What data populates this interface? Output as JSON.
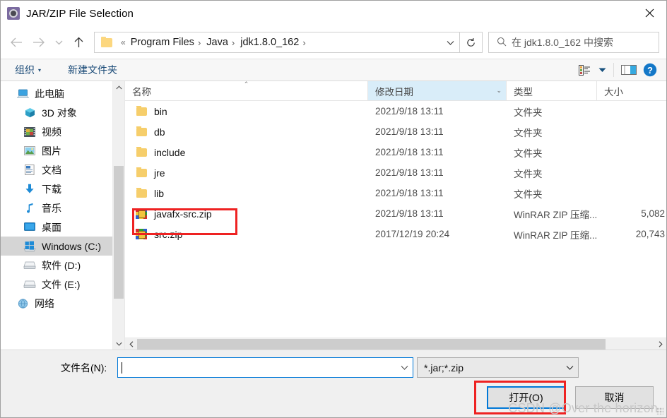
{
  "window": {
    "title": "JAR/ZIP File Selection",
    "title_icon": "java-gear-icon",
    "close_label": "×"
  },
  "nav": {
    "back_icon": "arrow-left-icon",
    "forward_icon": "arrow-right-icon",
    "recent_icon": "chevron-down-icon",
    "up_icon": "arrow-up-icon",
    "address": {
      "folder_icon": "folder-icon",
      "overflow": "«",
      "crumbs": [
        "Program Files",
        "Java",
        "jdk1.8.0_162"
      ],
      "separator": "›",
      "dropdown_icon": "chevron-down-icon"
    },
    "refresh_icon": "refresh-icon",
    "search": {
      "icon": "search-icon",
      "placeholder": "在 jdk1.8.0_162 中搜索",
      "value": ""
    }
  },
  "toolbar": {
    "organize_label": "组织",
    "organize_caret": "▾",
    "new_folder_label": "新建文件夹",
    "view_icon": "view-list-icon",
    "view_caret": "▾",
    "preview_icon": "preview-pane-icon",
    "help_icon": "help-icon",
    "help_glyph": "?"
  },
  "sidebar": {
    "items": [
      {
        "label": "此电脑",
        "icon": "this-pc-icon",
        "indent": false,
        "selected": false
      },
      {
        "label": "3D 对象",
        "icon": "3d-objects-icon",
        "indent": true,
        "selected": false
      },
      {
        "label": "视频",
        "icon": "videos-icon",
        "indent": true,
        "selected": false
      },
      {
        "label": "图片",
        "icon": "pictures-icon",
        "indent": true,
        "selected": false
      },
      {
        "label": "文档",
        "icon": "documents-icon",
        "indent": true,
        "selected": false
      },
      {
        "label": "下载",
        "icon": "downloads-icon",
        "indent": true,
        "selected": false
      },
      {
        "label": "音乐",
        "icon": "music-icon",
        "indent": true,
        "selected": false
      },
      {
        "label": "桌面",
        "icon": "desktop-icon",
        "indent": true,
        "selected": false
      },
      {
        "label": "Windows (C:)",
        "icon": "windows-drive-icon",
        "indent": true,
        "selected": true
      },
      {
        "label": "软件 (D:)",
        "icon": "drive-icon",
        "indent": true,
        "selected": false
      },
      {
        "label": "文件 (E:)",
        "icon": "drive-icon",
        "indent": true,
        "selected": false
      },
      {
        "label": "网络",
        "icon": "network-icon",
        "indent": false,
        "selected": false
      }
    ],
    "scroll_up_icon": "chevron-up-icon",
    "scroll_down_icon": "chevron-down-icon"
  },
  "filelist": {
    "columns": [
      {
        "label": "名称",
        "key": "name",
        "sorted": true,
        "sort_mark": "⌃"
      },
      {
        "label": "修改日期",
        "key": "date",
        "highlighted": true,
        "caret": "⌄"
      },
      {
        "label": "类型",
        "key": "type"
      },
      {
        "label": "大小",
        "key": "size"
      }
    ],
    "rows": [
      {
        "name": "bin",
        "icon": "folder-icon",
        "date": "2021/9/18 13:11",
        "type": "文件夹",
        "size": ""
      },
      {
        "name": "db",
        "icon": "folder-icon",
        "date": "2021/9/18 13:11",
        "type": "文件夹",
        "size": ""
      },
      {
        "name": "include",
        "icon": "folder-icon",
        "date": "2021/9/18 13:11",
        "type": "文件夹",
        "size": ""
      },
      {
        "name": "jre",
        "icon": "folder-icon",
        "date": "2021/9/18 13:11",
        "type": "文件夹",
        "size": ""
      },
      {
        "name": "lib",
        "icon": "folder-icon",
        "date": "2021/9/18 13:11",
        "type": "文件夹",
        "size": ""
      },
      {
        "name": "javafx-src.zip",
        "icon": "winrar-zip-icon",
        "date": "2021/9/18 13:11",
        "type": "WinRAR ZIP 压缩...",
        "size": "5,082"
      },
      {
        "name": "src.zip",
        "icon": "winrar-zip-icon",
        "date": "2017/12/19 20:24",
        "type": "WinRAR ZIP 压缩...",
        "size": "20,743"
      }
    ],
    "highlight_row_index": 6,
    "hscroll": {
      "left_icon": "chevron-left-icon",
      "right_icon": "chevron-right-icon"
    }
  },
  "footer": {
    "filename_label": "文件名(N):",
    "filename_value": "",
    "filename_dropdown_icon": "chevron-down-icon",
    "filter_value": "*.jar;*.zip",
    "filter_dropdown_icon": "chevron-down-icon",
    "open_button": "打开(O)",
    "cancel_button": "取消",
    "watermark": "CSDN @Over the horizon"
  },
  "colors": {
    "accent": "#0078d7",
    "highlight_red": "#ee2222",
    "column_highlight": "#d9edf9",
    "selection_gray": "#d5d5d5",
    "chrome_gray": "#f0f0f0"
  }
}
